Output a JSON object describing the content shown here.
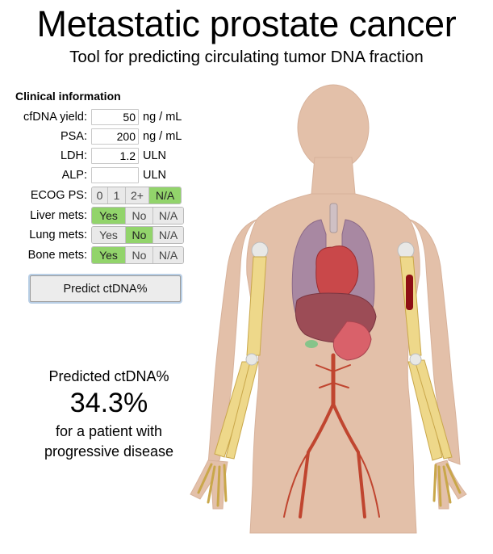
{
  "header": {
    "title": "Metastatic prostate cancer",
    "subtitle": "Tool for predicting circulating tumor DNA fraction"
  },
  "clinical": {
    "heading": "Clinical information",
    "fields": [
      {
        "label": "cfDNA yield:",
        "value": "50",
        "unit": "ng / mL"
      },
      {
        "label": "PSA:",
        "value": "200",
        "unit": "ng / mL"
      },
      {
        "label": "LDH:",
        "value": "1.2",
        "unit": "ULN"
      },
      {
        "label": "ALP:",
        "value": "",
        "unit": "ULN"
      }
    ],
    "toggles": [
      {
        "label": "ECOG PS:",
        "options": [
          "0",
          "1",
          "2+",
          "N/A"
        ],
        "selected": "N/A"
      },
      {
        "label": "Liver mets:",
        "options": [
          "Yes",
          "No",
          "N/A"
        ],
        "selected": "Yes"
      },
      {
        "label": "Lung mets:",
        "options": [
          "Yes",
          "No",
          "N/A"
        ],
        "selected": "No"
      },
      {
        "label": "Bone mets:",
        "options": [
          "Yes",
          "No",
          "N/A"
        ],
        "selected": "Yes"
      }
    ],
    "predict_label": "Predict ctDNA%"
  },
  "result": {
    "heading": "Predicted ctDNA%",
    "value": "34.3%",
    "line1": "for a patient with",
    "line2": "progressive disease"
  },
  "colors": {
    "selected_option": "#92d46b",
    "skin": "#e3c0a9",
    "bone": "#eed88a",
    "artery": "#c0452f",
    "lesion": "#8e0f14"
  },
  "anatomy": {
    "highlighted_regions": [
      "liver",
      "bone"
    ],
    "icons": [
      "human-body-silhouette",
      "skeleton-arm-bones",
      "heart",
      "lungs",
      "liver",
      "arteries",
      "bone-lesion"
    ]
  }
}
